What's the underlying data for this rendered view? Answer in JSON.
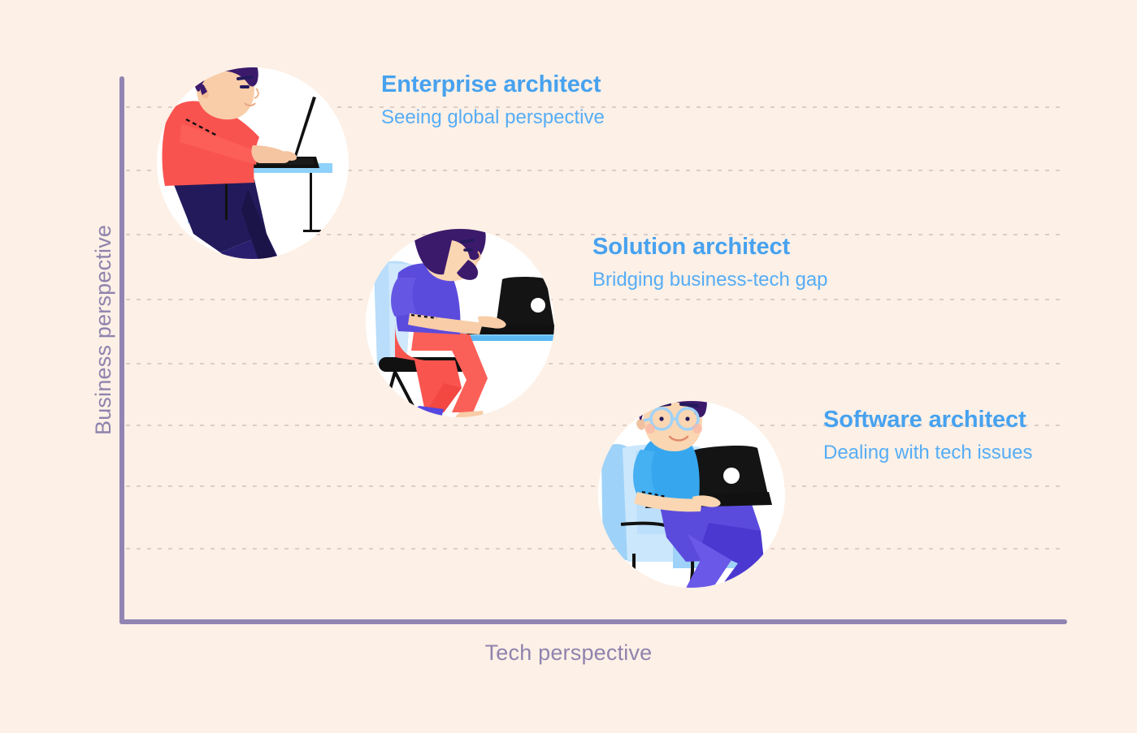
{
  "figure": {
    "background_color": "#fdf0e6",
    "axis_color": "#9184b3",
    "grid_color": "#c9b6b6",
    "title_color": "#47a2ef",
    "subtitle_color": "#56adf5",
    "axis_label_color": "#8f83ae"
  },
  "axes": {
    "y_label": "Business perspective",
    "x_label": "Tech perspective"
  },
  "chart_data": {
    "type": "scatter",
    "title": "",
    "subtitle": "",
    "xlabel": "Tech perspective",
    "ylabel": "Business perspective",
    "xlim": [
      0,
      10
    ],
    "ylim": [
      0,
      10
    ],
    "grid": true,
    "grid_lines_y": [
      8.8,
      7.9,
      6.8,
      5.8,
      4.7,
      3.5,
      2.4,
      1.3
    ],
    "legend": "none",
    "axis_ticks": "none",
    "points": [
      {
        "label": "Enterprise architect",
        "annotation": "Seeing global perspective",
        "x": 1.7,
        "y": 8.4,
        "marker": "illustration-man-at-desk",
        "marker_color": "#ffffff"
      },
      {
        "label": "Solution architect",
        "annotation": "Bridging business-tech gap",
        "x": 4.6,
        "y": 5.4,
        "marker": "illustration-woman-at-desk",
        "marker_color": "#ffffff"
      },
      {
        "label": "Software architect",
        "annotation": "Dealing with tech issues",
        "x": 7.3,
        "y": 2.3,
        "marker": "illustration-man-with-laptop",
        "marker_color": "#ffffff"
      }
    ]
  },
  "labels": [
    {
      "title": "Enterprise architect",
      "subtitle": "Seeing global perspective"
    },
    {
      "title": "Solution architect",
      "subtitle": "Bridging business-tech gap"
    },
    {
      "title": "Software architect",
      "subtitle": "Dealing with tech issues"
    }
  ]
}
